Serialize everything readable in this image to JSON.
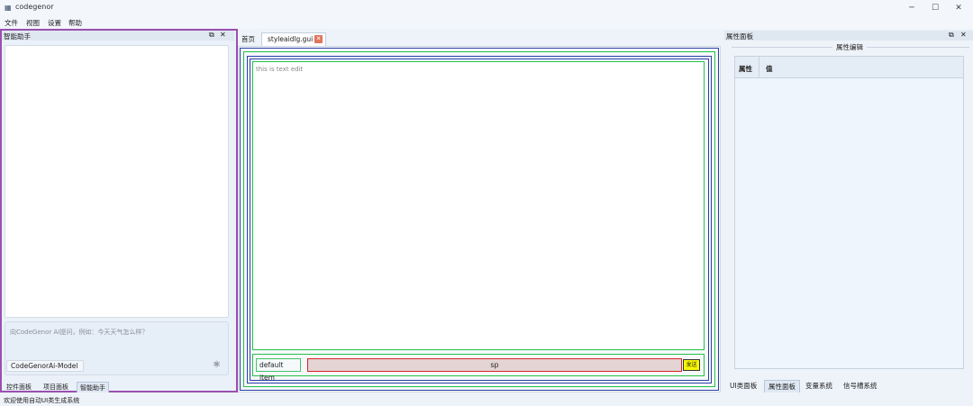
{
  "window": {
    "title": "codegenor",
    "icon": "app-window-icon"
  },
  "menu": [
    "文件",
    "视图",
    "设置",
    "帮助"
  ],
  "left_panel": {
    "title": "智能助手",
    "prompt_placeholder": "向CodeGenor AI提问，例如：今天天气怎么样？",
    "model": "CodeGenorAi-Model",
    "tabs": [
      "控件面板",
      "项目面板",
      "智能助手"
    ],
    "active_tab": "智能助手"
  },
  "center": {
    "tabs": [
      "首页",
      "styleaidlg.gui"
    ],
    "active_tab": "styleaidlg.gui",
    "text_edit_placeholder": "this is text edit",
    "combo_value": "default item",
    "input_value": "sp",
    "send_label": "发送",
    "frame_colors": {
      "blue": "#2b3fa8",
      "green": "#22c24a",
      "red": "#d7232a",
      "yellow": "#f6f700"
    }
  },
  "right_panel": {
    "title": "属性面板",
    "group_title": "属性编辑",
    "columns": [
      "属性",
      "值"
    ],
    "tabs": [
      "UI类面板",
      "属性面板",
      "变量系统",
      "信号槽系统"
    ],
    "active_tab": "属性面板"
  },
  "status": "欢迎使用自动UI类生成系统"
}
